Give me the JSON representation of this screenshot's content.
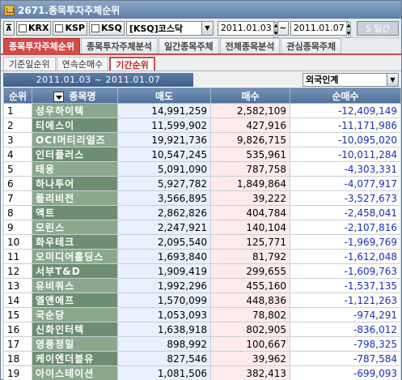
{
  "window": {
    "title": "2671.종목투자주체순위"
  },
  "toolbar": {
    "markets": [
      "KRX",
      "KSP",
      "KSQ"
    ],
    "market_select": "[KSQ]코스닥",
    "date_from": "2011.01.03",
    "date_sep": "~",
    "date_to": "2011.01.07",
    "period": "5 일간"
  },
  "tabs": [
    "종목투자주체순위",
    "종목투자주체분석",
    "일간종목주체",
    "전체종목분석",
    "관심종목주체"
  ],
  "subtabs": [
    "기준일순위",
    "연속순매수",
    "기간순위"
  ],
  "filter": {
    "range": "2011.01.03 ~ 2011.01.07",
    "investor": "외국인계"
  },
  "table": {
    "headers": {
      "rank": "순위",
      "name": "종목명",
      "sell": "매도",
      "buy": "매수",
      "net": "순매수"
    },
    "rows": [
      {
        "rank": "1",
        "name": "성우하이텍",
        "sell": "14,991,259",
        "buy": "2,582,109",
        "net": "-12,409,149"
      },
      {
        "rank": "2",
        "name": "티에스이",
        "sell": "11,599,902",
        "buy": "427,916",
        "net": "-11,171,986"
      },
      {
        "rank": "3",
        "name": "OCI머티리얼즈",
        "sell": "19,921,736",
        "buy": "9,826,715",
        "net": "-10,095,020"
      },
      {
        "rank": "4",
        "name": "인터플러스",
        "sell": "10,547,245",
        "buy": "535,961",
        "net": "-10,011,284"
      },
      {
        "rank": "5",
        "name": "태웅",
        "sell": "5,091,090",
        "buy": "787,758",
        "net": "-4,303,331"
      },
      {
        "rank": "6",
        "name": "하나투어",
        "sell": "5,927,782",
        "buy": "1,849,864",
        "net": "-4,077,917"
      },
      {
        "rank": "7",
        "name": "플리비전",
        "sell": "3,566,895",
        "buy": "39,222",
        "net": "-3,527,673"
      },
      {
        "rank": "8",
        "name": "액트",
        "sell": "2,862,826",
        "buy": "404,784",
        "net": "-2,458,041"
      },
      {
        "rank": "9",
        "name": "모린스",
        "sell": "2,247,921",
        "buy": "140,104",
        "net": "-2,107,816"
      },
      {
        "rank": "10",
        "name": "화우테크",
        "sell": "2,095,540",
        "buy": "125,771",
        "net": "-1,969,769"
      },
      {
        "rank": "11",
        "name": "오미디어홀딩스",
        "sell": "1,693,840",
        "buy": "81,792",
        "net": "-1,612,048"
      },
      {
        "rank": "12",
        "name": "서부T&D",
        "sell": "1,909,419",
        "buy": "299,655",
        "net": "-1,609,763"
      },
      {
        "rank": "13",
        "name": "유비쿼스",
        "sell": "1,992,296",
        "buy": "455,160",
        "net": "-1,537,135"
      },
      {
        "rank": "14",
        "name": "엘앤에프",
        "sell": "1,570,099",
        "buy": "448,836",
        "net": "-1,121,263"
      },
      {
        "rank": "15",
        "name": "국순당",
        "sell": "1,053,093",
        "buy": "78,802",
        "net": "-974,291"
      },
      {
        "rank": "16",
        "name": "신화인터텍",
        "sell": "1,638,918",
        "buy": "802,905",
        "net": "-836,012"
      },
      {
        "rank": "17",
        "name": "영풍정밀",
        "sell": "898,992",
        "buy": "100,667",
        "net": "-798,325"
      },
      {
        "rank": "18",
        "name": "케이엔더블유",
        "sell": "827,546",
        "buy": "39,962",
        "net": "-787,584"
      },
      {
        "rank": "19",
        "name": "아이스테이션",
        "sell": "1,081,506",
        "buy": "382,413",
        "net": "-699,093"
      }
    ]
  }
}
